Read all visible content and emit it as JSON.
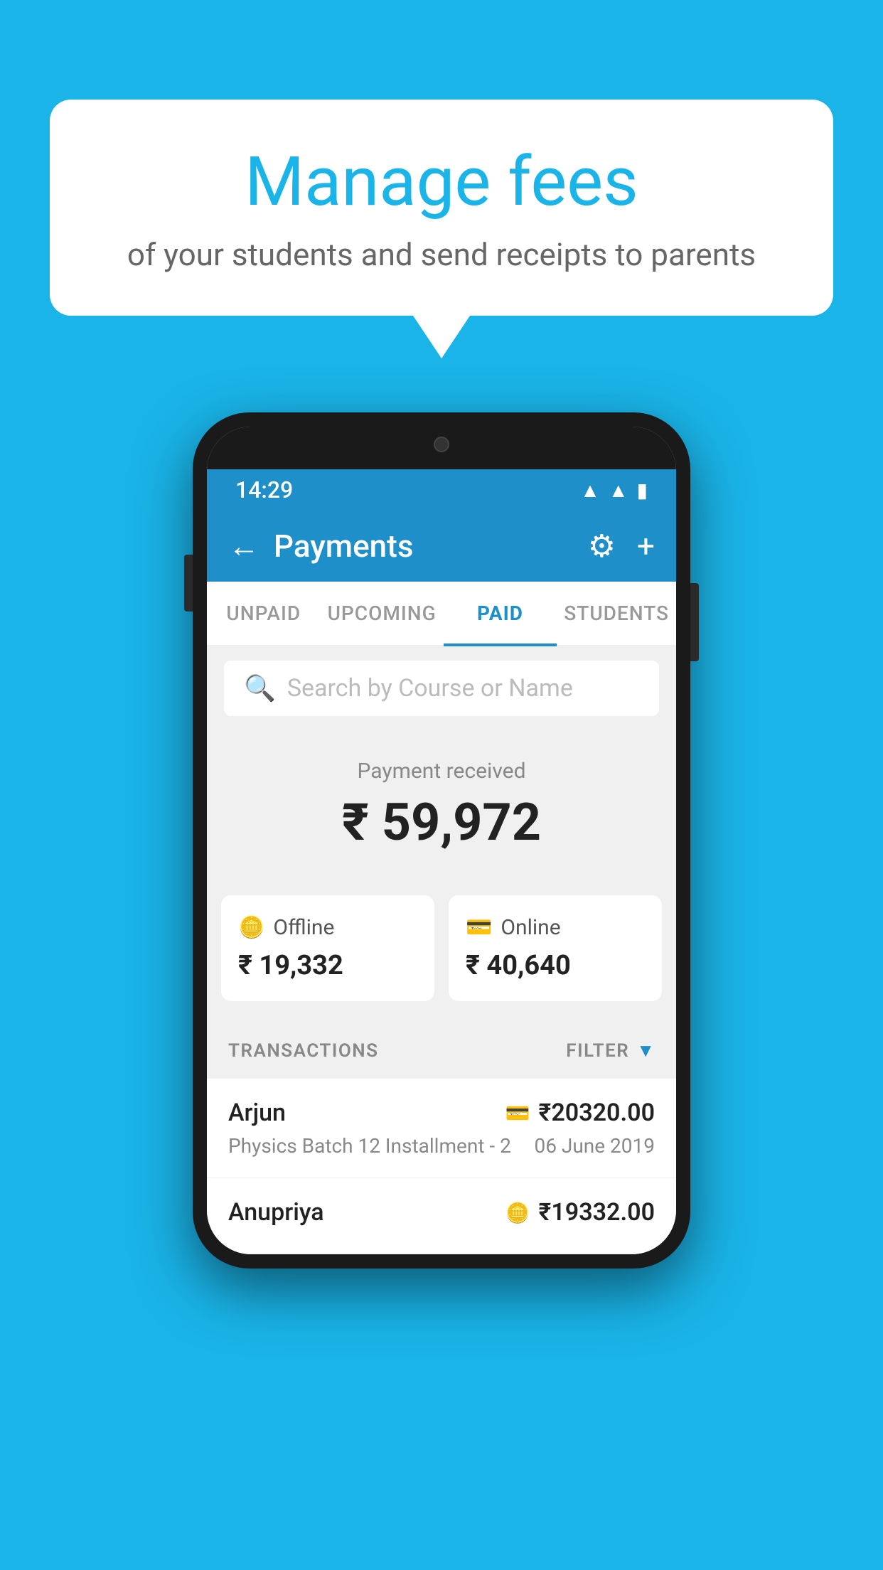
{
  "background_color": "#1ab4e8",
  "speech_bubble": {
    "title": "Manage fees",
    "subtitle": "of your students and send receipts to parents"
  },
  "phone": {
    "status_bar": {
      "time": "14:29",
      "icons": [
        "wifi",
        "signal",
        "battery"
      ]
    },
    "header": {
      "title": "Payments",
      "back_label": "←",
      "gear_label": "⚙",
      "plus_label": "+"
    },
    "tabs": [
      {
        "label": "UNPAID",
        "active": false
      },
      {
        "label": "UPCOMING",
        "active": false
      },
      {
        "label": "PAID",
        "active": true
      },
      {
        "label": "STUDENTS",
        "active": false
      }
    ],
    "search": {
      "placeholder": "Search by Course or Name"
    },
    "payment_section": {
      "label": "Payment received",
      "amount": "₹ 59,972",
      "offline": {
        "label": "Offline",
        "amount": "₹ 19,332"
      },
      "online": {
        "label": "Online",
        "amount": "₹ 40,640"
      }
    },
    "transactions": {
      "header_label": "TRANSACTIONS",
      "filter_label": "FILTER",
      "rows": [
        {
          "name": "Arjun",
          "amount": "₹20320.00",
          "course": "Physics Batch 12 Installment - 2",
          "date": "06 June 2019",
          "payment_type": "online"
        },
        {
          "name": "Anupriya",
          "amount": "₹19332.00",
          "course": "",
          "date": "",
          "payment_type": "offline"
        }
      ]
    }
  }
}
